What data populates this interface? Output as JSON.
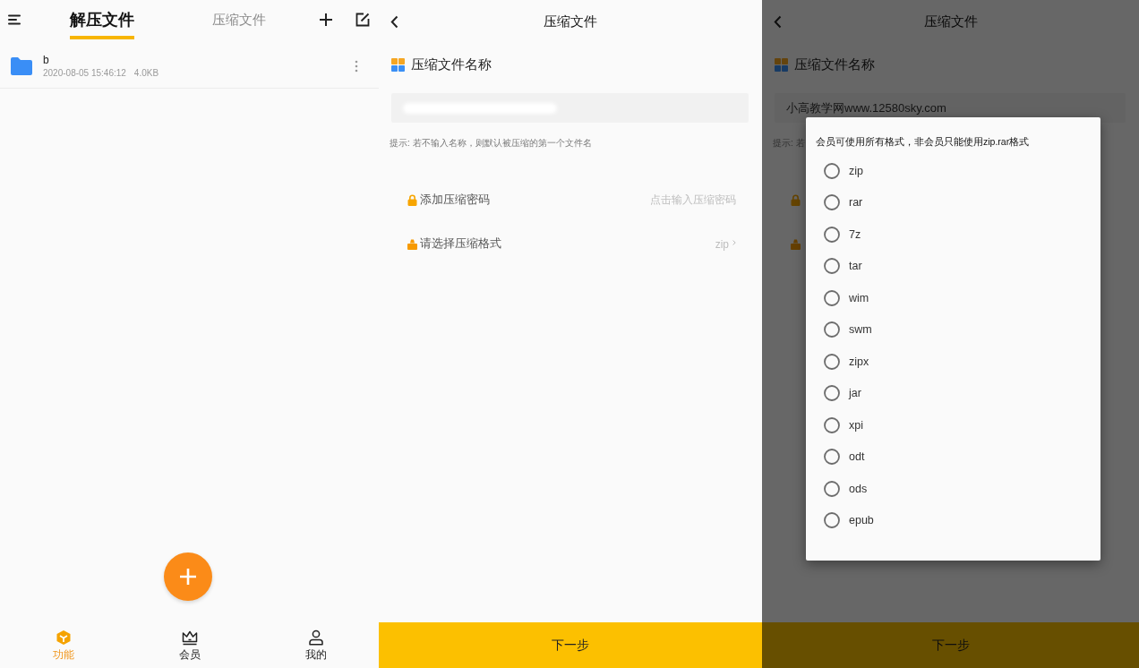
{
  "screens": [
    {
      "kind": "file_browser",
      "tabs": [
        {
          "label": "解压文件",
          "selected": true
        },
        {
          "label": "压缩文件",
          "selected": false
        }
      ],
      "files": [
        {
          "name": "b",
          "modified": "2020-08-05 15:46:12",
          "size": "4.0KB"
        }
      ],
      "bottom_nav": [
        {
          "label": "功能",
          "selected": true
        },
        {
          "label": "会员",
          "selected": false
        },
        {
          "label": "我的",
          "selected": false
        }
      ]
    },
    {
      "kind": "compress_form",
      "title": "压缩文件",
      "name_section": {
        "label": "压缩文件名称",
        "field": {
          "redacted": true
        },
        "hint": "提示: 若不输入名称，则默认被压缩的第一个文件名"
      },
      "options": [
        {
          "kind": "password",
          "label": "添加压缩密码",
          "value": "点击输入压缩密码"
        },
        {
          "kind": "format",
          "label": "请选择压缩格式",
          "value": "zip"
        }
      ],
      "next_button": "下一步"
    },
    {
      "kind": "compress_form",
      "title": "压缩文件",
      "name_section": {
        "label": "压缩文件名称",
        "field": {
          "value": "小高教学网www.12580sky.com",
          "redacted": false
        },
        "hint": "提示: 若"
      },
      "options": [
        {
          "kind": "password"
        },
        {
          "kind": "format"
        }
      ],
      "next_button": "下一步",
      "dialog": {
        "message": "会员可使用所有格式，非会员只能使用zip.rar格式",
        "formats": [
          {
            "label": "zip",
            "selected": false
          },
          {
            "label": "rar",
            "selected": false
          },
          {
            "label": "7z",
            "selected": false
          },
          {
            "label": "tar",
            "selected": false
          },
          {
            "label": "wim",
            "selected": false
          },
          {
            "label": "swm",
            "selected": false
          },
          {
            "label": "zipx",
            "selected": false
          },
          {
            "label": "jar",
            "selected": false
          },
          {
            "label": "xpi",
            "selected": false
          },
          {
            "label": "odt",
            "selected": false
          },
          {
            "label": "ods",
            "selected": false
          },
          {
            "label": "epub",
            "selected": false
          }
        ]
      }
    }
  ]
}
